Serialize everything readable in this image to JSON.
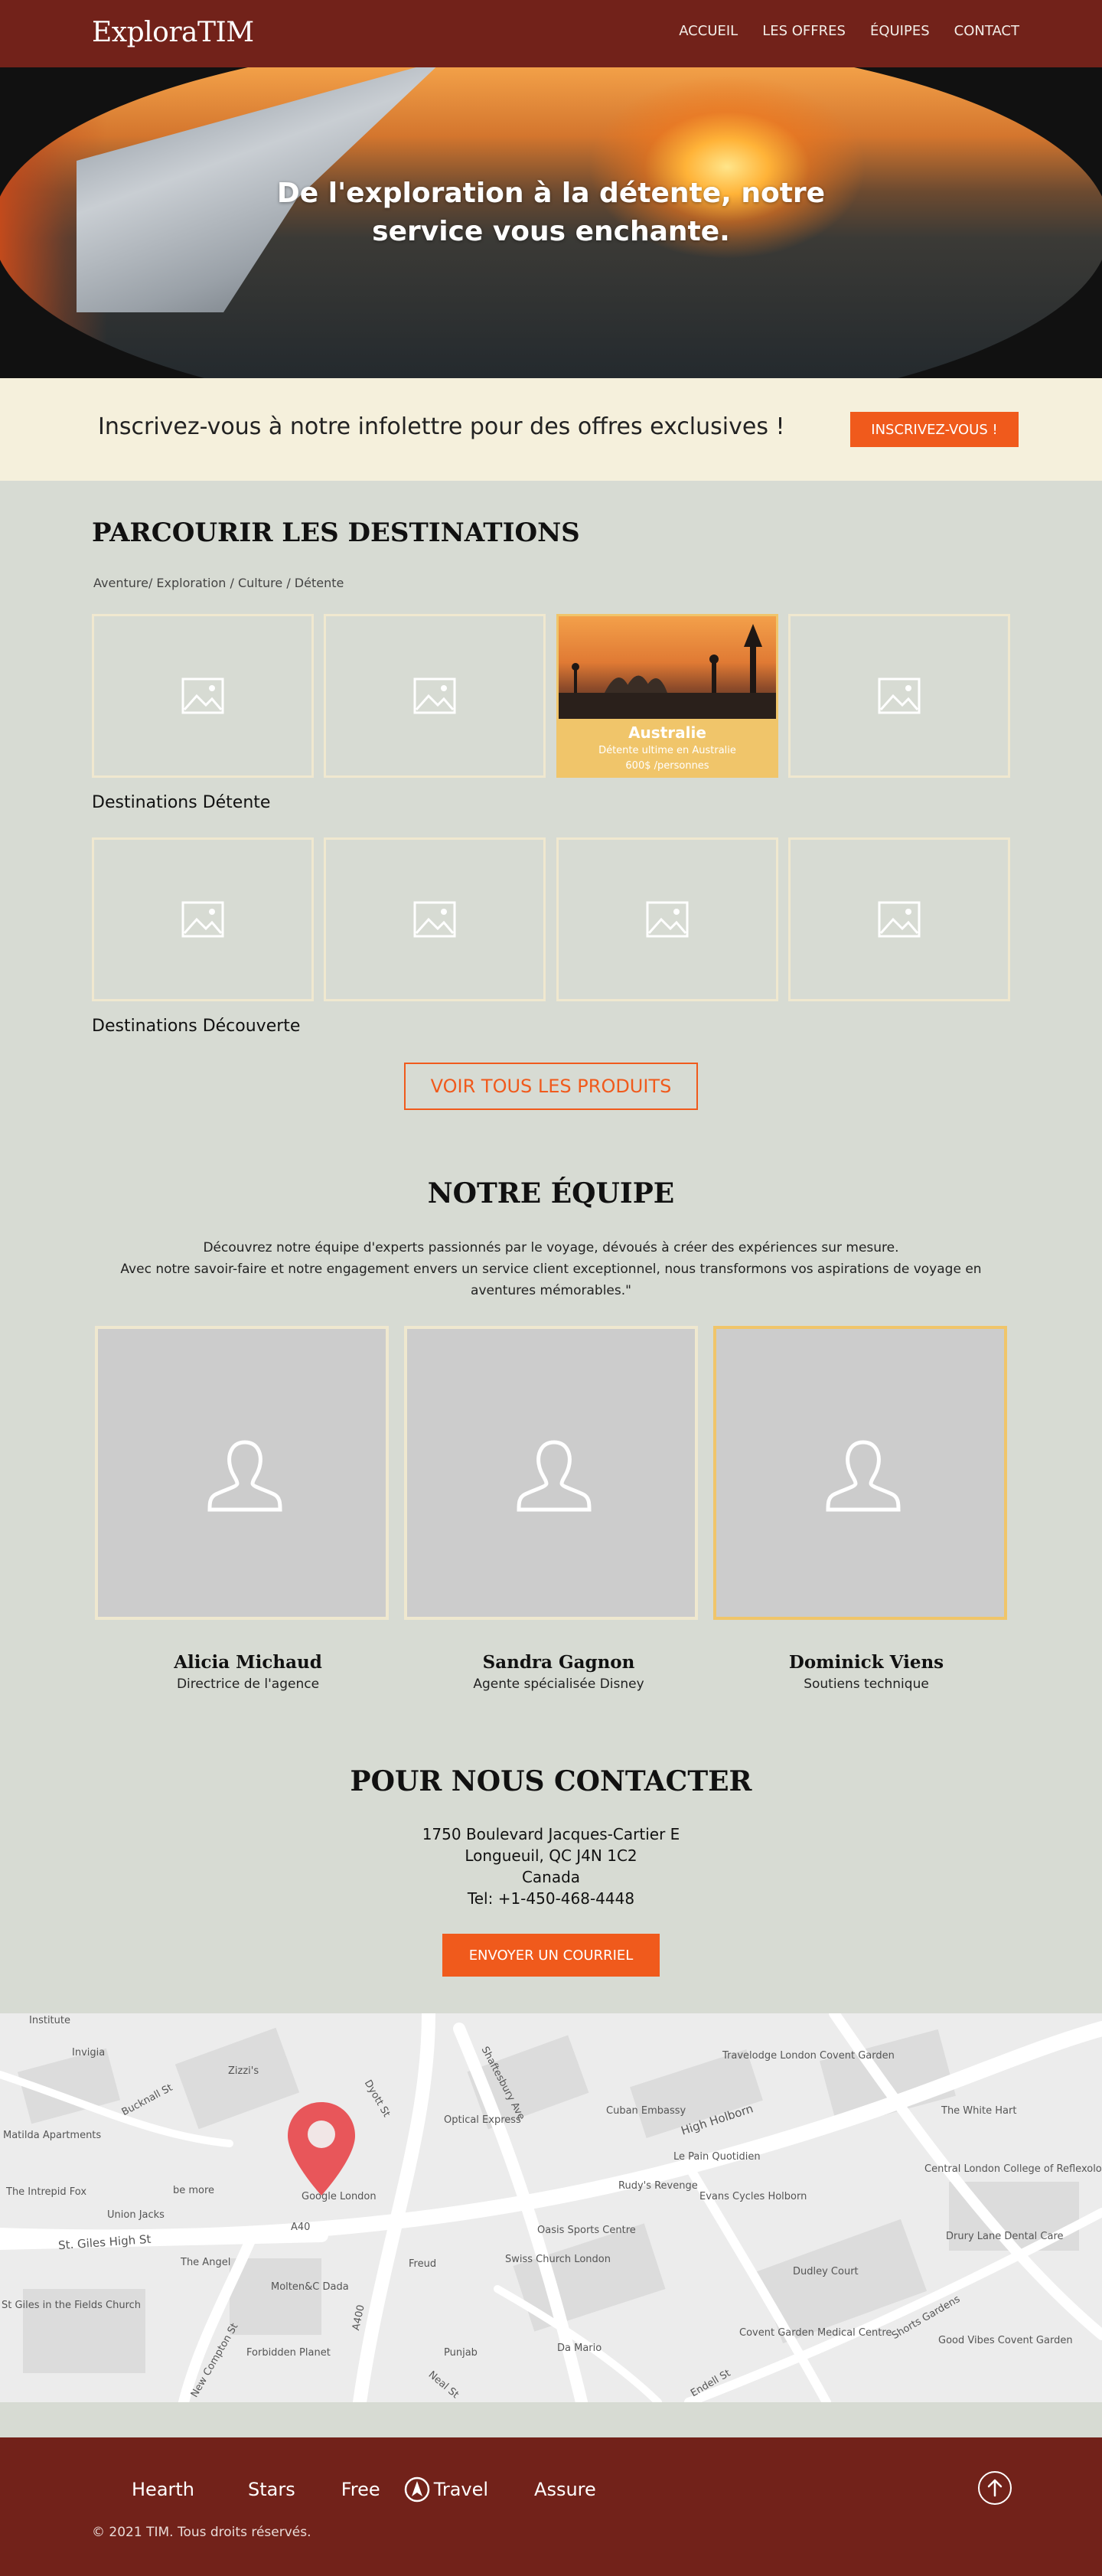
{
  "brand": {
    "logo": "ExploraTIM"
  },
  "nav": {
    "items": [
      "ACCUEIL",
      "LES OFFRES",
      "ÉQUIPES",
      "CONTACT"
    ]
  },
  "hero": {
    "title": "De l'exploration à la détente, notre service vous enchante."
  },
  "newsletter": {
    "text": "Inscrivez-vous à notre infolettre pour des offres exclusives !",
    "button": "INSCRIVEZ-VOUS !"
  },
  "destinations": {
    "title": "PARCOURIR LES DESTINATIONS",
    "filters": "Aventure/ Exploration / Culture / Détente",
    "featured": {
      "name": "Australie",
      "description": "Détente ultime en Australie",
      "capacity": "600$ /personnes"
    },
    "category_relax": "Destinations Détente",
    "category_discovery": "Destinations Découverte",
    "view_all": "VOIR TOUS LES PRODUITS"
  },
  "team": {
    "title": "NOTRE ÉQUIPE",
    "intro_line1": "Découvrez notre équipe d'experts passionnés par le voyage, dévoués à créer des expériences sur mesure.",
    "intro_line2": "Avec notre savoir-faire et notre engagement envers un service client exceptionnel, nous transformons vos aspirations de voyage en aventures mémorables.\"",
    "members": [
      {
        "name": "Alicia Michaud",
        "role": "Directrice de l'agence"
      },
      {
        "name": "Sandra Gagnon",
        "role": "Agente spécialisée Disney"
      },
      {
        "name": "Dominick Viens",
        "role": "Soutiens technique"
      }
    ]
  },
  "contact": {
    "title": "POUR NOUS CONTACTER",
    "address1": "1750 Boulevard Jacques-Cartier E",
    "address2": "Longueuil, QC J4N 1C2",
    "country": "Canada",
    "phone": "Tel: +1-450-468-4448",
    "button": "ENVOYER UN COURRIEL"
  },
  "map": {
    "labels": [
      "Institute",
      "Invigia",
      "Zizzi's",
      "Bucknall St",
      "Matilda Apartments",
      "The Intrepid Fox",
      "Union Jacks",
      "be more",
      "Google London",
      "St. Giles High St",
      "A40",
      "The Angel",
      "Optical Express",
      "Shaftesbury Ave",
      "Cuban Embassy",
      "High Holborn",
      "Travelodge London Covent Garden",
      "The White Hart",
      "Le Pain Quotidien",
      "Rudy's Revenge",
      "Evans Cycles Holborn",
      "Oasis Sports Centre",
      "Swiss Church London",
      "Freud",
      "Molten&C Dada",
      "Forbidden Planet",
      "Punjab",
      "Da Mario",
      "Dudley Court",
      "Covent Garden Medical Centre",
      "Central London College of Reflexology",
      "Drury Lane Dental Care",
      "Shorts Gardens",
      "Good Vibes Covent Garden",
      "St Giles in the Fields Church",
      "New Compton St",
      "A400",
      "Neal St",
      "Endell St",
      "Dyott St"
    ]
  },
  "footer": {
    "links": [
      "Hearth",
      "Stars",
      "Free",
      "Travel",
      "Assure"
    ],
    "copyright": "© 2021 TIM. Tous droits réservés."
  },
  "colors": {
    "header": "#72221a",
    "accent": "#f05a1c",
    "featured": "#f0c56a",
    "background": "#d7dbd3",
    "newsletter_bg": "#f5f0dc"
  }
}
